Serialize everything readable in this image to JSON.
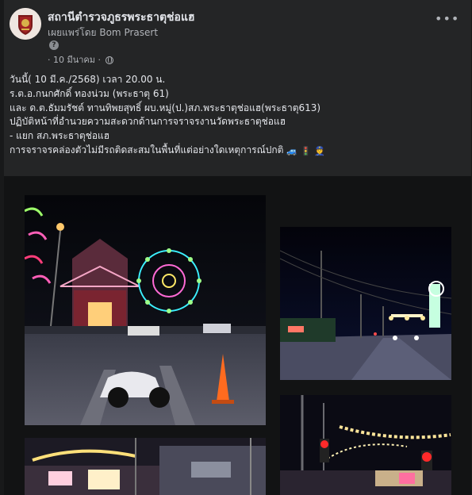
{
  "post": {
    "page_name": "สถานีตำรวจภูธรพระธาตุช่อแฮ",
    "byline_prefix": "เผยแพร่โดย",
    "author": "Bom Prasert",
    "help_glyph": "?",
    "date": "· 10 มีนาคม ·",
    "more_glyph": "•••",
    "lines": [
      "วันนี้( 10 มี.ค./2568) เวลา 20.00 น.",
      " ร.ต.อ.กนกศักดิ์  ทองน่วม (พระธาตุ 61)",
      " และ  ด.ต.ธัมมรัชต์ ทานทิพยสุทธิ์ ผบ.หมู่(ป.)สภ.พระธาตุช่อแฮ(พระธาตุ613)",
      "ปฏิบัติหน้าที่อำนวยความสะดวกด้านการจราจรงานวัดพระธาตุช่อแฮ",
      "- แยก สภ.พระธาตุช่อแฮ",
      "การจราจรคล่องตัวไม่มีรถติดสะสมในพื้นที่แต่อย่างใดเหตุการณ์ปกติ"
    ],
    "emojis": [
      "🚙",
      "🚦",
      "👮"
    ]
  },
  "colors": {
    "card_bg": "#242526",
    "text_primary": "#e4e6eb",
    "text_secondary": "#b0b3b8",
    "photo_bg": "#121314"
  },
  "photos": [
    {
      "name": "photo-ferris-wheel-scooter"
    },
    {
      "name": "photo-road-night-lights"
    },
    {
      "name": "photo-market-stalls-lights"
    },
    {
      "name": "photo-traffic-lights-festival"
    }
  ]
}
